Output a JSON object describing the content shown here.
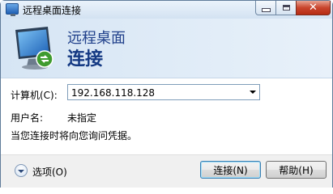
{
  "window": {
    "title": "远程桌面连接"
  },
  "banner": {
    "line1": "远程桌面",
    "line2": "连接"
  },
  "form": {
    "computer_label": "计算机(C):",
    "computer_value": "192.168.118.128",
    "username_label": "用户名:",
    "username_value": "未指定",
    "info": "当您连接时将向您询问凭据。"
  },
  "footer": {
    "options_label": "选项(O)",
    "connect_label": "连接(N)",
    "help_label": "帮助(H)"
  },
  "icons": {
    "app": "remote-desktop-icon",
    "banner": "monitor-remote-icon",
    "minimize": "minimize-icon",
    "maximize": "maximize-icon",
    "close": "close-icon",
    "options": "expand-options-icon",
    "dropdown": "chevron-down-icon"
  },
  "colors": {
    "banner_text": "#143983",
    "close_button": "#c9452d",
    "window_frame": "#dfeaf5"
  }
}
